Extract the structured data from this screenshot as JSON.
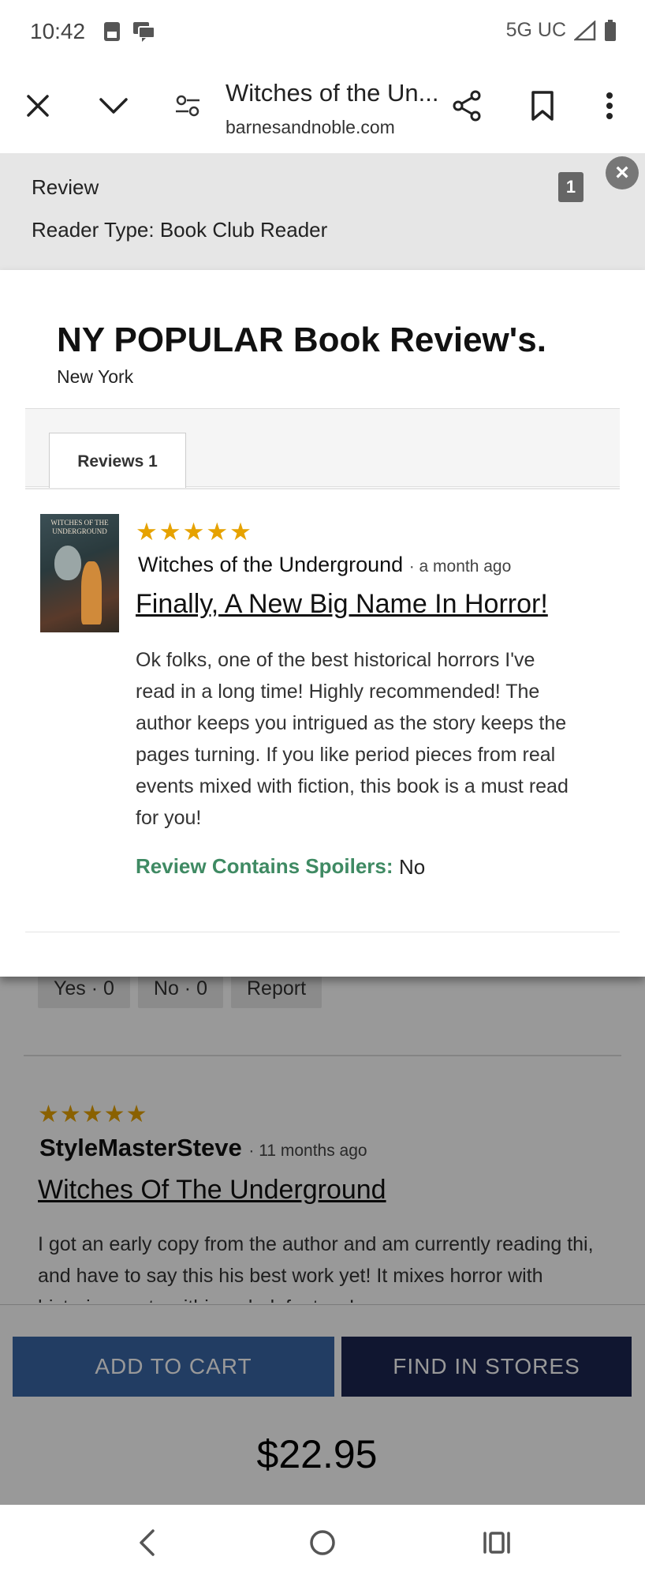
{
  "status_bar": {
    "time": "10:42",
    "network": "5G UC",
    "icons": [
      "sim-card-icon",
      "message-icon",
      "signal-icon",
      "battery-icon"
    ]
  },
  "toolbar": {
    "page_title": "Witches of the Un...",
    "url": "barnesandnoble.com",
    "icons": [
      "close-icon",
      "chevron-down-icon",
      "site-settings-icon",
      "share-icon",
      "bookmark-icon",
      "more-vert-icon"
    ]
  },
  "modal": {
    "header": {
      "review_label": "Review",
      "reader_type": "Reader Type: Book Club Reader",
      "count": "1"
    },
    "reviewer": {
      "name": "NY POPULAR Book Review's.",
      "location": "New York"
    },
    "tab_label": "Reviews 1",
    "review": {
      "stars": "★★★★★",
      "book_title": "Witches of the Underground",
      "time": "· a month ago",
      "title": "Finally, A New Big Name In Horror!",
      "text": "Ok folks, one of the best historical horrors I've read in a long time! Highly recommended! The author keeps you intrigued as the story keeps the pages turning. If you like period pieces from real events mixed with fiction, this book is a must read for you!",
      "spoiler_label": "Review Contains Spoilers:",
      "spoiler_value": "No",
      "cover_text": "WITCHES OF THE UNDERGROUND"
    }
  },
  "background": {
    "votes": {
      "yes": "Yes · 0",
      "no": "No · 0",
      "report": "Report"
    },
    "review": {
      "stars": "★★★★★",
      "author": "StyleMasterSteve",
      "time": "· 11 months ago",
      "title": "Witches Of The Underground",
      "text": "I got an early copy from the author and am currently reading thi, and have to say this his best work yet! It mixes horror with historic events within a dark fantasy!"
    }
  },
  "bottom_bar": {
    "add_to_cart": "ADD TO CART",
    "find_in_stores": "FIND IN STORES",
    "price": "$22.95"
  },
  "nav_bar": {
    "icons": [
      "back-icon",
      "home-icon",
      "recents-icon"
    ]
  },
  "colors": {
    "star": "#e6a200",
    "spoiler_green": "#3f8a63",
    "cart_blue": "#3a66a6",
    "stores_navy": "#1b2651"
  }
}
